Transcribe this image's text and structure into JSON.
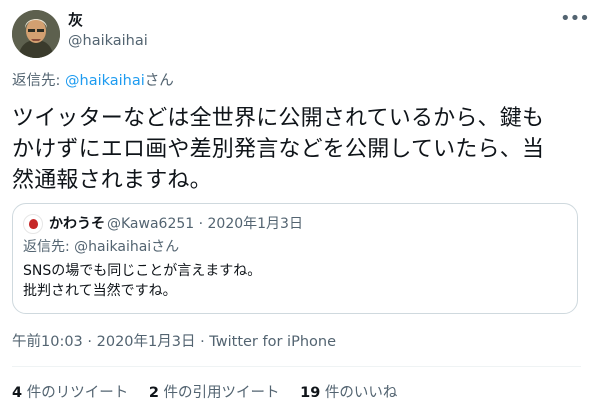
{
  "author": {
    "display_name": "灰",
    "handle": "@haikaihai"
  },
  "reply_to": {
    "prefix": "返信先: ",
    "handle": "@haikaihai",
    "suffix": "さん"
  },
  "tweet": {
    "text_line1": "ツイッターなどは全世界に公開されているから、鍵も",
    "text_line2": "かけずにエロ画や差別発言などを公開していたら、当",
    "text_line3": "然通報されますね。"
  },
  "quote": {
    "name": "かわうそ",
    "meta": "@Kawa6251 · 2020年1月3日",
    "reply_to": "返信先: @haikaihaiさん",
    "text_line1": "SNSの場でも同じことが言えますね。",
    "text_line2": "批判されて当然ですね。"
  },
  "timestamp": "午前10:03 · 2020年1月3日 · Twitter for iPhone",
  "stats": {
    "retweets_count": "4",
    "retweets_label": " 件のリツイート",
    "quotes_count": "2",
    "quotes_label": " 件の引用ツイート",
    "likes_count": "19",
    "likes_label": " 件のいいね"
  },
  "icons": {
    "more": "more-options-icon",
    "avatar": "user-avatar",
    "quote_avatar": "quote-user-avatar"
  },
  "colors": {
    "link": "#1d9bf0",
    "secondary_text": "#536471",
    "primary_text": "#0f1419",
    "border": "#cfd9de"
  }
}
